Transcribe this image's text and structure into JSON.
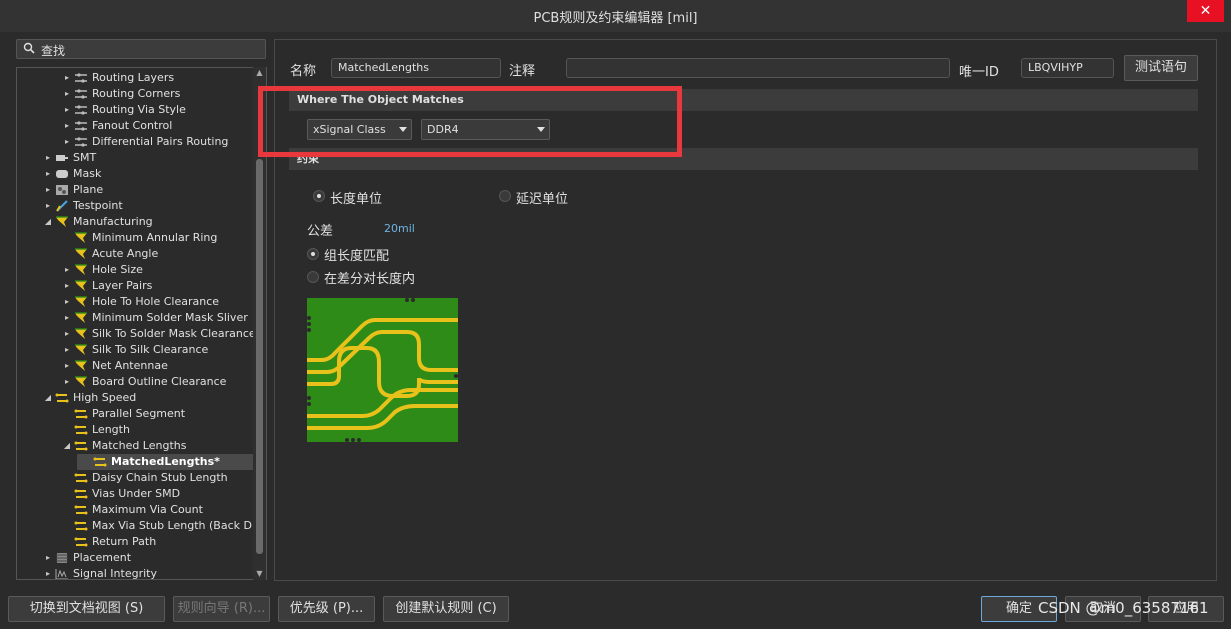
{
  "window": {
    "title": "PCB规则及约束编辑器 [mil]",
    "close_glyph": "✕"
  },
  "search": {
    "label": "查找"
  },
  "tree": {
    "items": [
      {
        "label": "Routing Layers",
        "icon": "routing-rule-icon",
        "arrow": "▸"
      },
      {
        "label": "Routing Corners",
        "icon": "routing-rule-icon",
        "arrow": "▸"
      },
      {
        "label": "Routing Via Style",
        "icon": "routing-rule-icon",
        "arrow": "▸"
      },
      {
        "label": "Fanout Control",
        "icon": "routing-rule-icon",
        "arrow": "▸"
      },
      {
        "label": "Differential Pairs Routing",
        "icon": "routing-rule-icon",
        "arrow": "▸"
      },
      {
        "label": "SMT",
        "icon": "smt-icon",
        "arrow": "▸"
      },
      {
        "label": "Mask",
        "icon": "mask-icon",
        "arrow": "▸"
      },
      {
        "label": "Plane",
        "icon": "plane-icon",
        "arrow": "▸"
      },
      {
        "label": "Testpoint",
        "icon": "testpoint-icon",
        "arrow": "▸"
      },
      {
        "label": "Manufacturing",
        "icon": "manufacturing-icon",
        "arrow": "◢"
      },
      {
        "label": "Minimum Annular Ring",
        "icon": "manufacturing-icon",
        "arrow": ""
      },
      {
        "label": "Acute Angle",
        "icon": "manufacturing-icon",
        "arrow": ""
      },
      {
        "label": "Hole Size",
        "icon": "manufacturing-icon",
        "arrow": "▸"
      },
      {
        "label": "Layer Pairs",
        "icon": "manufacturing-icon",
        "arrow": "▸"
      },
      {
        "label": "Hole To Hole Clearance",
        "icon": "manufacturing-icon",
        "arrow": "▸"
      },
      {
        "label": "Minimum Solder Mask Sliver",
        "icon": "manufacturing-icon",
        "arrow": "▸"
      },
      {
        "label": "Silk To Solder Mask Clearance",
        "icon": "manufacturing-icon",
        "arrow": "▸"
      },
      {
        "label": "Silk To Silk Clearance",
        "icon": "manufacturing-icon",
        "arrow": "▸"
      },
      {
        "label": "Net Antennae",
        "icon": "manufacturing-icon",
        "arrow": "▸"
      },
      {
        "label": "Board Outline Clearance",
        "icon": "manufacturing-icon",
        "arrow": "▸"
      },
      {
        "label": "High Speed",
        "icon": "high-speed-icon",
        "arrow": "◢"
      },
      {
        "label": "Parallel Segment",
        "icon": "high-speed-icon",
        "arrow": ""
      },
      {
        "label": "Length",
        "icon": "high-speed-icon",
        "arrow": ""
      },
      {
        "label": "Matched Lengths",
        "icon": "high-speed-icon",
        "arrow": "◢"
      },
      {
        "label": "MatchedLengths*",
        "icon": "high-speed-icon",
        "arrow": ""
      },
      {
        "label": "Daisy Chain Stub Length",
        "icon": "high-speed-icon",
        "arrow": ""
      },
      {
        "label": "Vias Under SMD",
        "icon": "high-speed-icon",
        "arrow": ""
      },
      {
        "label": "Maximum Via Count",
        "icon": "high-speed-icon",
        "arrow": ""
      },
      {
        "label": "Max Via Stub Length (Back Drill",
        "icon": "high-speed-icon",
        "arrow": ""
      },
      {
        "label": "Return Path",
        "icon": "high-speed-icon",
        "arrow": ""
      },
      {
        "label": "Placement",
        "icon": "placement-icon",
        "arrow": "▸"
      },
      {
        "label": "Signal Integrity",
        "icon": "signal-integrity-icon",
        "arrow": "▸"
      }
    ]
  },
  "form": {
    "name_label": "名称",
    "name_value": "MatchedLengths",
    "comment_label": "注释",
    "comment_value": "",
    "uid_label": "唯一ID",
    "uid_value": "LBQVIHYP",
    "test_button": "测试语句"
  },
  "where": {
    "header": "Where The Object Matches",
    "type_select": "xSignal Class",
    "value_select": "DDR4"
  },
  "constraints": {
    "header": "约束",
    "unit_length": "长度单位",
    "unit_delay": "延迟单位",
    "tolerance_label": "公差",
    "tolerance_value": "20mil",
    "group_match": "组长度匹配",
    "within_pair": "在差分对长度内",
    "unit_length_selected": true,
    "group_match_selected": true
  },
  "footer": {
    "switch_view": "切换到文档视图 (S)",
    "wizard": "规则向导 (R)...",
    "priorities": "优先级 (P)...",
    "create_default": "创建默认规则 (C)",
    "ok": "确定",
    "cancel": "取消",
    "apply": "应用"
  },
  "watermark": "CSDN @m0_63587161",
  "colors": {
    "highlight": "#e8383d",
    "pcb_green": "#2e8b17",
    "trace_yellow": "#e8c21a"
  }
}
